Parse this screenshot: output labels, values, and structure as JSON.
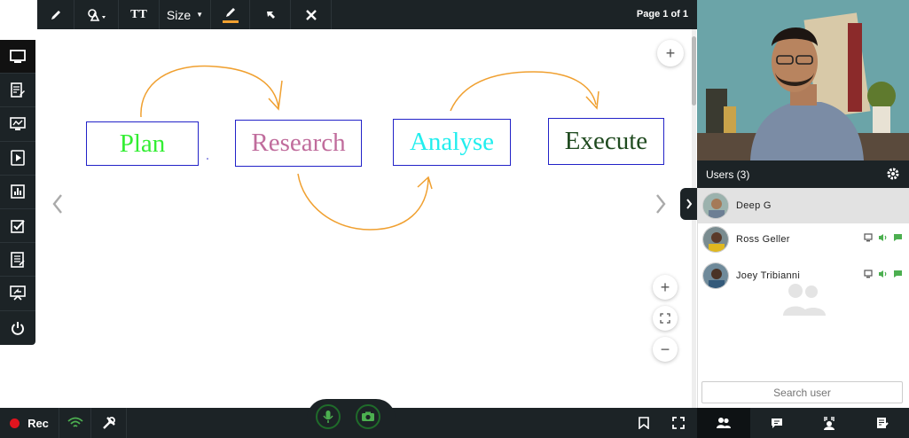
{
  "toolbar": {
    "size_label": "Size",
    "text_tool_label": "TT",
    "page_indicator": "Page 1 of 1",
    "pen_color": "#f0a030"
  },
  "sidebar": {
    "items": [
      {
        "name": "whiteboard-icon",
        "active": true
      },
      {
        "name": "document-edit-icon"
      },
      {
        "name": "screenshare-icon"
      },
      {
        "name": "video-play-icon"
      },
      {
        "name": "poll-chart-icon"
      },
      {
        "name": "quiz-checkbox-icon"
      },
      {
        "name": "notes-icon"
      },
      {
        "name": "presentation-share-icon"
      },
      {
        "name": "power-icon"
      }
    ]
  },
  "board": {
    "boxes": [
      {
        "text": "Plan",
        "color": "#33ee33"
      },
      {
        "text": "Research",
        "color": "#c06c9c"
      },
      {
        "text": "Analyse",
        "color": "#22eeee"
      },
      {
        "text": "Execute",
        "color": "#1f4a1f"
      }
    ],
    "arrow_color": "#f0a030"
  },
  "users": {
    "header": "Users (3)",
    "list": [
      {
        "name": "Deep G",
        "selected": true
      },
      {
        "name": "Ross Geller"
      },
      {
        "name": "Joey Tribianni"
      }
    ],
    "search_placeholder": "Search user"
  },
  "bottom": {
    "rec_label": "Rec"
  },
  "colors": {
    "dark": "#1c2326",
    "accent_green": "#4caf50",
    "rec_red": "#e0141e"
  }
}
